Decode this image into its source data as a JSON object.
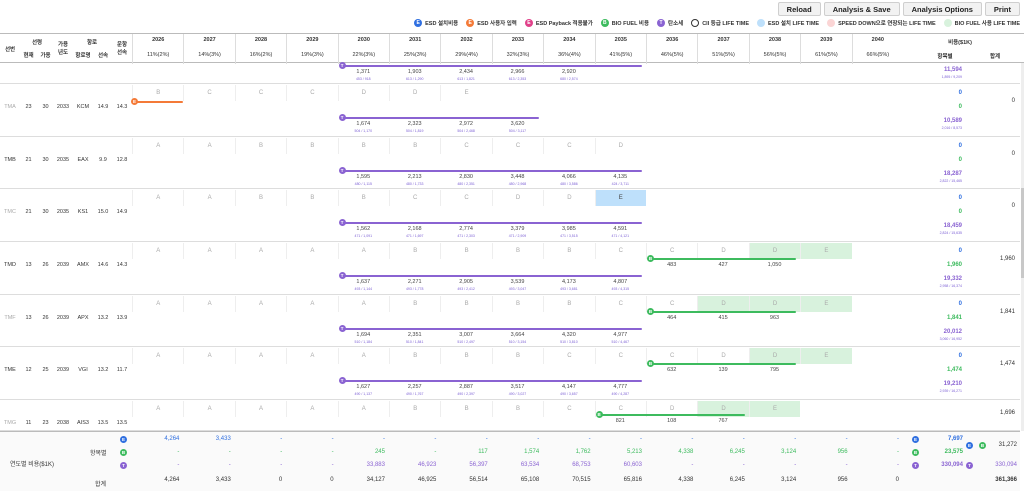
{
  "toolbar": {
    "reload": "Reload",
    "analysis_save": "Analysis & Save",
    "analysis_options": "Analysis Options",
    "print": "Print"
  },
  "legend": [
    {
      "badge": "E",
      "label": "ESD 설치비용",
      "color": "#2f6fe0",
      "shape": "dot"
    },
    {
      "badge": "E",
      "label": "ESD 사용자 입력",
      "color": "#f47a38",
      "shape": "dot"
    },
    {
      "badge": "E",
      "label": "ESD Payback 적용불가",
      "color": "#e0408a",
      "shape": "dot"
    },
    {
      "badge": "B",
      "label": "BIO FUEL 비용",
      "color": "#3dbb5e",
      "shape": "dot"
    },
    {
      "badge": "T",
      "label": "탄소세",
      "color": "#8a63d2",
      "shape": "dot"
    },
    {
      "badge": "",
      "label": "CII 등급 LIFE TIME",
      "color": "#ffffff",
      "shape": "ring"
    },
    {
      "badge": "",
      "label": "ESD 설치 LIFE TIME",
      "color": "#bee0fb",
      "shape": "fill"
    },
    {
      "badge": "",
      "label": "SPEED DOWN으로 연장되는 LIFE TIME",
      "color": "#fbd5d5",
      "shape": "fill"
    },
    {
      "badge": "",
      "label": "BIO FUEL 사용 LIFE TIME",
      "color": "#d8f2dd",
      "shape": "fill"
    }
  ],
  "header": {
    "ship": "선번",
    "age": "선령",
    "age_now": "현재",
    "age_avail": "가용",
    "avail_year": "가용\n년도",
    "route": "항로",
    "route_name": "항로명",
    "speed": "선속",
    "op_speed": "운항\n선속",
    "cost": "비용($1K)",
    "by_item": "항목별",
    "total": "합계"
  },
  "years": [
    {
      "year": "2026",
      "cii": "11%(2%)"
    },
    {
      "year": "2027",
      "cii": "14%(3%)"
    },
    {
      "year": "2028",
      "cii": "16%(2%)"
    },
    {
      "year": "2029",
      "cii": "19%(3%)"
    },
    {
      "year": "2030",
      "cii": "22%(3%)"
    },
    {
      "year": "2031",
      "cii": "25%(3%)"
    },
    {
      "year": "2032",
      "cii": "29%(4%)"
    },
    {
      "year": "2033",
      "cii": "32%(3%)"
    },
    {
      "year": "2034",
      "cii": "36%(4%)"
    },
    {
      "year": "2035",
      "cii": "41%(5%)"
    },
    {
      "year": "2036",
      "cii": "46%(5%)"
    },
    {
      "year": "2037",
      "cii": "51%(5%)"
    },
    {
      "year": "2038",
      "cii": "56%(5%)"
    },
    {
      "year": "2039",
      "cii": "61%(5%)"
    },
    {
      "year": "2040",
      "cii": "66%(5%)"
    }
  ],
  "rows": [
    {
      "id": "",
      "top_carbon": {
        "start": 4,
        "end": 9,
        "values": [
          "1,371",
          "1,903",
          "2,434",
          "2,966",
          "2,920"
        ],
        "subs": [
          "453 / 918",
          "613 / 1,290",
          "613 / 1,821",
          "613 / 2,353",
          "680 / 2,574"
        ]
      },
      "right": {
        "e": "",
        "b": "",
        "t": "11,594",
        "t_sub": "1,895 / 9,209"
      },
      "total": ""
    },
    {
      "id": "TMA",
      "now": "23",
      "avail": "30",
      "year": "2033",
      "route": "KCM",
      "sp": "14.9",
      "op": "14.3",
      "grades": [
        "B",
        "C",
        "C",
        "C",
        "D",
        "D",
        "E"
      ],
      "grade_start": 0,
      "cls": [
        "",
        "",
        "",
        "",
        "",
        "",
        ""
      ],
      "orange": {
        "start": 0,
        "end": 0.9
      },
      "carbon": {
        "start": 4,
        "end": 7,
        "values": [
          "1,674",
          "2,323",
          "2,972",
          "3,620"
        ],
        "subs": [
          "504 / 1,170",
          "504 / 1,819",
          "504 / 2,468",
          "504 / 3,117"
        ]
      },
      "right": {
        "e": "0",
        "b": "0",
        "t": "10,589",
        "t_sub": "2,016 / 8,573"
      },
      "total": "0"
    },
    {
      "id": "TMB",
      "now": "21",
      "avail": "30",
      "year": "2035",
      "route": "EAX",
      "sp": "9.9",
      "op": "12.8",
      "grades": [
        "A",
        "A",
        "B",
        "B",
        "B",
        "B",
        "C",
        "C",
        "C",
        "D"
      ],
      "grade_start": 0,
      "cls": [
        "",
        "",
        "",
        "",
        "",
        "",
        "",
        "",
        "",
        ""
      ],
      "carbon": {
        "start": 4,
        "end": 9,
        "values": [
          "1,595",
          "2,213",
          "2,830",
          "3,448",
          "4,066",
          "4,135"
        ],
        "subs": [
          "480 / 1,115",
          "480 / 1,733",
          "480 / 2,351",
          "480 / 2,968",
          "480 / 3,586",
          "424 / 3,711"
        ]
      },
      "right": {
        "e": "0",
        "b": "0",
        "t": "18,287",
        "t_sub": "2,822 / 15,465"
      },
      "total": "0"
    },
    {
      "id": "TMC",
      "now": "21",
      "avail": "30",
      "year": "2035",
      "route": "KS1",
      "sp": "15.0",
      "op": "14.9",
      "grades": [
        "A",
        "A",
        "B",
        "B",
        "B",
        "C",
        "C",
        "D",
        "D",
        "E"
      ],
      "grade_start": 0,
      "cls": [
        "",
        "",
        "",
        "",
        "",
        "",
        "",
        "",
        "",
        "bl"
      ],
      "carbon": {
        "start": 4,
        "end": 9,
        "values": [
          "1,562",
          "2,168",
          "2,774",
          "3,379",
          "3,985",
          "4,591"
        ],
        "subs": [
          "471 / 1,091",
          "471 / 1,697",
          "471 / 2,303",
          "471 / 2,909",
          "471 / 3,515",
          "471 / 4,121"
        ]
      },
      "right": {
        "e": "0",
        "b": "0",
        "t": "18,459",
        "t_sub": "2,824 / 15,635"
      },
      "total": "0"
    },
    {
      "id": "TMD",
      "now": "13",
      "avail": "26",
      "year": "2039",
      "route": "AMX",
      "sp": "14.6",
      "op": "14.3",
      "grades": [
        "A",
        "A",
        "A",
        "A",
        "A",
        "B",
        "B",
        "B",
        "B",
        "C",
        "C",
        "D",
        "D",
        "E"
      ],
      "grade_start": 0,
      "cls": [
        "",
        "",
        "",
        "",
        "",
        "",
        "",
        "",
        "",
        "",
        "",
        "",
        "gr",
        "gr"
      ],
      "carbon": {
        "start": 4,
        "end": 9,
        "values": [
          "1,637",
          "2,271",
          "2,905",
          "3,539",
          "4,173",
          "4,807"
        ],
        "subs": [
          "493 / 1,144",
          "493 / 1,778",
          "493 / 2,412",
          "493 / 3,047",
          "493 / 3,681",
          "493 / 4,315"
        ]
      },
      "bio": {
        "start": 10,
        "end": 13,
        "values": [
          "483",
          "427",
          "1,050"
        ]
      },
      "right": {
        "e": "0",
        "b": "1,960",
        "t": "19,332",
        "t_sub": "2,958 / 16,374"
      },
      "total": "1,960"
    },
    {
      "id": "TMF",
      "now": "13",
      "avail": "26",
      "year": "2039",
      "route": "APX",
      "sp": "13.2",
      "op": "13.9",
      "grades": [
        "A",
        "A",
        "A",
        "A",
        "A",
        "B",
        "B",
        "B",
        "B",
        "C",
        "C",
        "D",
        "D",
        "E"
      ],
      "grade_start": 0,
      "cls": [
        "",
        "",
        "",
        "",
        "",
        "",
        "",
        "",
        "",
        "",
        "",
        "gr",
        "gr",
        "gr"
      ],
      "carbon": {
        "start": 4,
        "end": 9,
        "values": [
          "1,694",
          "2,351",
          "3,007",
          "3,664",
          "4,320",
          "4,977"
        ],
        "subs": [
          "510 / 1,184",
          "510 / 1,841",
          "510 / 2,497",
          "510 / 3,154",
          "510 / 3,810",
          "510 / 4,467"
        ]
      },
      "bio": {
        "start": 10,
        "end": 13,
        "values": [
          "464",
          "415",
          "963"
        ]
      },
      "right": {
        "e": "0",
        "b": "1,841",
        "t": "20,012",
        "t_sub": "3,060 / 16,952"
      },
      "total": "1,841"
    },
    {
      "id": "TME",
      "now": "12",
      "avail": "25",
      "year": "2039",
      "route": "VGI",
      "sp": "13.2",
      "op": "11.7",
      "grades": [
        "A",
        "A",
        "A",
        "A",
        "A",
        "B",
        "B",
        "B",
        "C",
        "C",
        "C",
        "D",
        "D",
        "E"
      ],
      "grade_start": 0,
      "cls": [
        "",
        "",
        "",
        "",
        "",
        "",
        "",
        "",
        "",
        "",
        "",
        "",
        "gr",
        "gr"
      ],
      "carbon": {
        "start": 4,
        "end": 9,
        "values": [
          "1,627",
          "2,257",
          "2,887",
          "3,517",
          "4,147",
          "4,777"
        ],
        "subs": [
          "490 / 1,137",
          "490 / 1,767",
          "490 / 2,397",
          "490 / 3,027",
          "490 / 3,657",
          "490 / 4,287"
        ]
      },
      "bio": {
        "start": 10,
        "end": 13,
        "values": [
          "632",
          "139",
          "795"
        ]
      },
      "right": {
        "e": "0",
        "b": "1,474",
        "t": "19,210",
        "t_sub": "2,939 / 16,271"
      },
      "total": "1,474"
    },
    {
      "id": "TMG",
      "now": "11",
      "avail": "23",
      "year": "2038",
      "route": "AIS3",
      "sp": "13.5",
      "op": "13.5",
      "grades": [
        "A",
        "A",
        "A",
        "A",
        "A",
        "B",
        "B",
        "B",
        "C",
        "C",
        "D",
        "D",
        "E"
      ],
      "grade_start": 0,
      "cls": [
        "",
        "",
        "",
        "",
        "",
        "",
        "",
        "",
        "",
        "",
        "",
        "gr",
        "gr"
      ],
      "bio": {
        "start": 9,
        "end": 12,
        "values": [
          "821",
          "108",
          "767"
        ]
      },
      "right": {
        "e": "",
        "b": "",
        "t": "",
        "t_sub": ""
      },
      "total": "1,696"
    }
  ],
  "footer": {
    "label": "연도별 비용($1K)",
    "by_item": "항목별",
    "total": "합계",
    "e_row": [
      "4,264",
      "3,433",
      "-",
      "-",
      "-",
      "-",
      "-",
      "-",
      "-",
      "-",
      "-",
      "-",
      "-",
      "-",
      "-"
    ],
    "b_row": [
      "-",
      "-",
      "-",
      "-",
      "245",
      "-",
      "117",
      "1,574",
      "1,762",
      "5,213",
      "4,338",
      "6,245",
      "3,124",
      "956",
      "-"
    ],
    "t_row": [
      "-",
      "-",
      "-",
      "-",
      "33,883",
      "46,923",
      "56,397",
      "63,534",
      "68,753",
      "60,603",
      "-",
      "-",
      "-",
      "-",
      "-"
    ],
    "sum_row": [
      "4,264",
      "3,433",
      "0",
      "0",
      "34,127",
      "46,925",
      "56,514",
      "65,108",
      "70,515",
      "65,816",
      "4,338",
      "6,245",
      "3,124",
      "956",
      "0"
    ],
    "right_e": "7,697",
    "right_b": "23,575",
    "right_t": "330,094",
    "right_t2": "330,094",
    "eb_total": "31,272",
    "grand_total": "361,366"
  },
  "colors": {
    "esd": "#2f6fe0",
    "orange": "#f47a38",
    "bio": "#3dbb5e",
    "carbon": "#8a63d2"
  }
}
